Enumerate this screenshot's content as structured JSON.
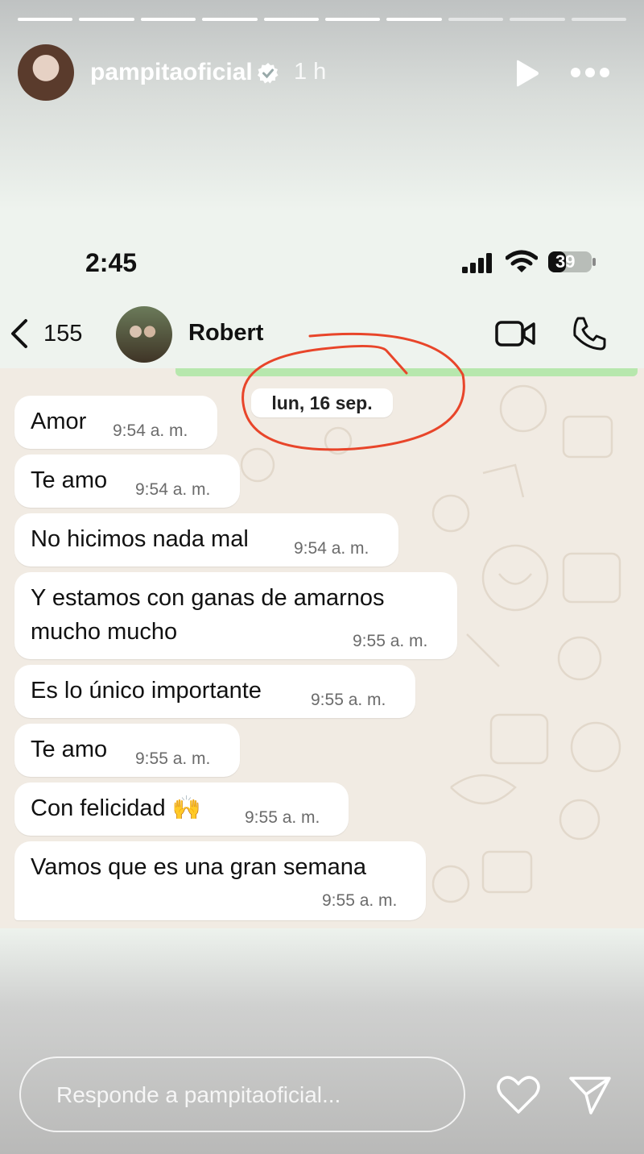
{
  "story": {
    "username": "pampitaoficial",
    "time_ago": "1 h",
    "progress": {
      "segments": 10,
      "completed": 7
    },
    "icons": [
      "verified-badge-icon",
      "play-icon",
      "more-icon"
    ]
  },
  "screenshot": {
    "status_bar": {
      "time": "2:45",
      "battery": "39"
    },
    "chat_header": {
      "back_count": "155",
      "contact_name": "Robert"
    },
    "date_label": "lun, 16 sep.",
    "messages": [
      {
        "text": "Amor",
        "time": "9:54 a. m."
      },
      {
        "text": "Te amo",
        "time": "9:54 a. m."
      },
      {
        "text": "No hicimos nada mal",
        "time": "9:54 a. m."
      },
      {
        "text_line1": "Y estamos con ganas de amarnos",
        "text_line2": "mucho mucho",
        "time": "9:55 a. m."
      },
      {
        "text": "Es lo único importante",
        "time": "9:55 a. m."
      },
      {
        "text": "Te amo",
        "time": "9:55 a. m."
      },
      {
        "text": "Con felicidad 🙌",
        "time": "9:55 a. m."
      },
      {
        "text": "Vamos que es una gran semana",
        "time": "9:55 a. m."
      }
    ]
  },
  "footer": {
    "reply_placeholder": "Responde a pampitaoficial..."
  },
  "colors": {
    "annotation_circle": "#e8452a",
    "chat_bg": "#f1ebe3",
    "bubble": "#ffffff"
  }
}
